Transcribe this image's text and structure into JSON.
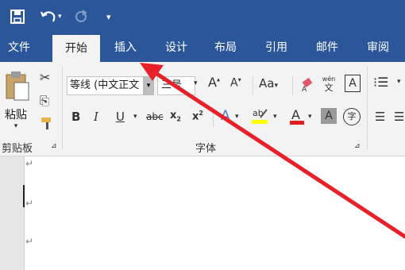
{
  "qat": {
    "save_icon": "save-icon",
    "undo_icon": "undo-icon",
    "redo_icon": "redo-icon",
    "customize_icon": "customize-qat-icon"
  },
  "tabs": [
    {
      "label": "文件"
    },
    {
      "label": "开始"
    },
    {
      "label": "插入"
    },
    {
      "label": "设计"
    },
    {
      "label": "布局"
    },
    {
      "label": "引用"
    },
    {
      "label": "邮件"
    },
    {
      "label": "审阅"
    }
  ],
  "clipboard": {
    "paste_label": "粘贴",
    "group_label": "剪贴板"
  },
  "font": {
    "font_name": "等线 (中文正文",
    "font_size": "三号",
    "case_label": "Aa",
    "pinyin_top": "wén",
    "pinyin_bottom": "文",
    "border_char": "A",
    "shade_char": "A",
    "enclose_char": "字",
    "group_label": "字体"
  },
  "accent_color": "#2b579a",
  "arrow_color": "#e8202a"
}
